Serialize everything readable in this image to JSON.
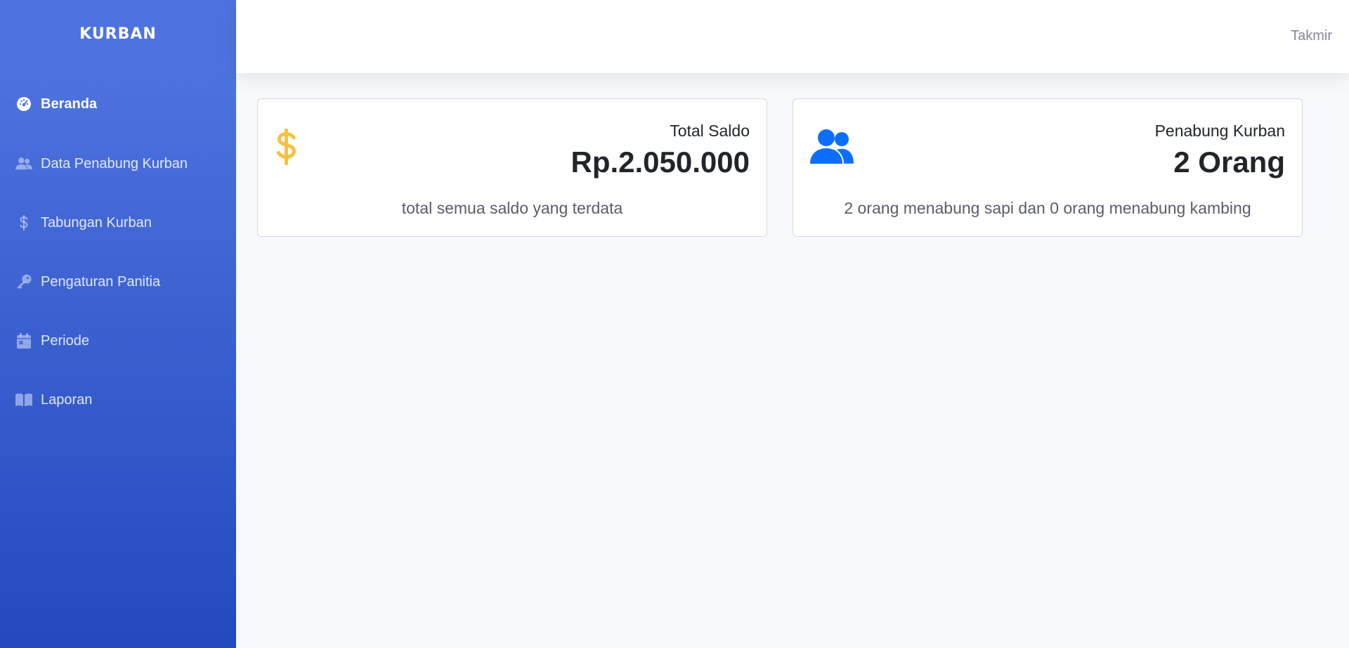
{
  "sidebar": {
    "brand": "KURBAN",
    "items": [
      {
        "label": "Beranda",
        "icon": "tachometer-icon",
        "active": true
      },
      {
        "label": "Data Penabung Kurban",
        "icon": "users-icon",
        "active": false
      },
      {
        "label": "Tabungan Kurban",
        "icon": "dollar-icon",
        "active": false
      },
      {
        "label": "Pengaturan Panitia",
        "icon": "key-icon",
        "active": false
      },
      {
        "label": "Periode",
        "icon": "calendar-icon",
        "active": false
      },
      {
        "label": "Laporan",
        "icon": "book-icon",
        "active": false
      }
    ]
  },
  "topbar": {
    "user": "Takmir"
  },
  "cards": [
    {
      "title": "Total Saldo",
      "value": "Rp.2.050.000",
      "description": "total semua saldo yang terdata",
      "icon": "dollar-icon",
      "icon_color": "#f6c23e"
    },
    {
      "title": "Penabung Kurban",
      "value": "2 Orang",
      "description": "2 orang menabung sapi dan 0 orang menabung kambing",
      "icon": "users-icon",
      "icon_color": "#0d6efd"
    }
  ],
  "colors": {
    "sidebar_top": "#4e73df",
    "sidebar_bottom": "#224abe",
    "background": "#f8f9fc"
  }
}
